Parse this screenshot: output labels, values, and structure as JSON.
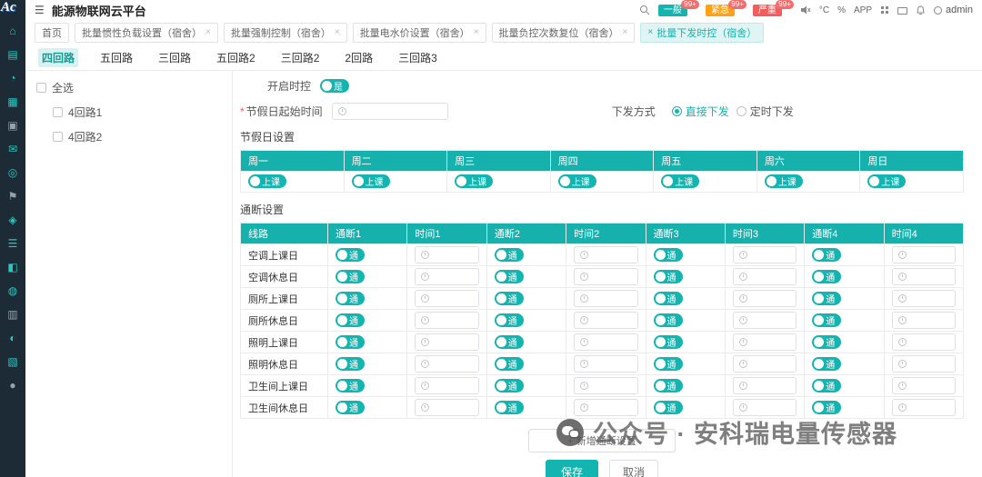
{
  "app": {
    "logo": "Ac",
    "title": "能源物联网云平台",
    "user": "admin"
  },
  "header": {
    "badges": [
      {
        "label": "一般",
        "count": "99+"
      },
      {
        "label": "紧急",
        "count": "99+"
      },
      {
        "label": "严重",
        "count": "99+"
      }
    ],
    "temperature": "°C",
    "humidity": "%",
    "app_label": "APP"
  },
  "tabs": {
    "items": [
      "首页",
      "批量惯性负载设置（宿舍）",
      "批量强制控制（宿舍）",
      "批量电水价设置（宿舍）",
      "批量负控次数复位（宿舍）",
      "批量下发时控（宿舍）"
    ],
    "active_index": 5
  },
  "subtabs": {
    "items": [
      "四回路",
      "五回路",
      "三回路",
      "五回路2",
      "三回路2",
      "2回路",
      "三回路3"
    ],
    "active_index": 0
  },
  "tree": {
    "select_all": "全选",
    "items": [
      "4回路1",
      "4回路2"
    ]
  },
  "form": {
    "enable_label": "开启时控",
    "enable_state": "是",
    "holiday_start_label": "节假日起始时间",
    "dispatch_label": "下发方式",
    "dispatch_direct": "直接下发",
    "dispatch_timed": "定时下发"
  },
  "holiday": {
    "section_title": "节假日设置",
    "days": [
      "周一",
      "周二",
      "周三",
      "周四",
      "周五",
      "周六",
      "周日"
    ],
    "toggle_label": "上课"
  },
  "onoff": {
    "section_title": "通断设置",
    "headers": [
      "线路",
      "通断1",
      "时间1",
      "通断2",
      "时间2",
      "通断3",
      "时间3",
      "通断4",
      "时间4"
    ],
    "rows": [
      "空调上课日",
      "空调休息日",
      "厕所上课日",
      "厕所休息日",
      "照明上课日",
      "照明休息日",
      "卫生间上课日",
      "卫生间休息日"
    ],
    "toggle_label": "通"
  },
  "actions": {
    "add_label": "+ 新增通断设置",
    "save_label": "保存",
    "cancel_label": "取消"
  },
  "watermark": {
    "text": "公众号 · 安科瑞电量传感器"
  },
  "colors": {
    "accent": "#14b5b0",
    "sidebar": "#1d2b36",
    "urgent": "#ffa216",
    "severe": "#f25e5e",
    "count_badge": "#f56c6c"
  }
}
